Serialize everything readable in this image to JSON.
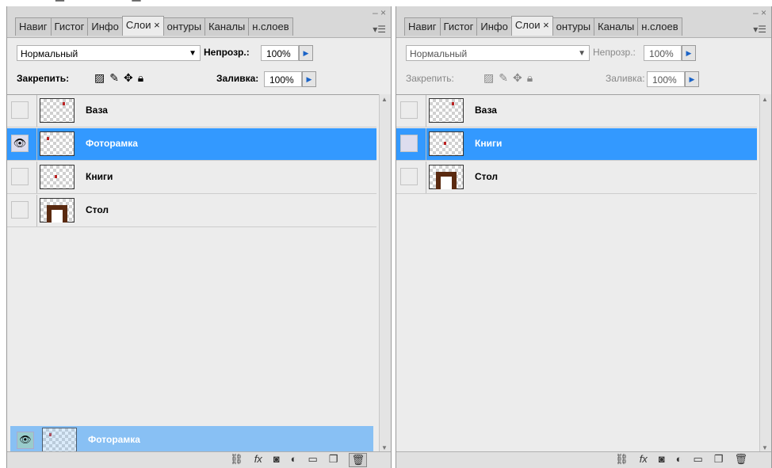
{
  "panels": [
    {
      "tabs": [
        {
          "label": "Навиг"
        },
        {
          "label": "Гистог"
        },
        {
          "label": "Инфо"
        },
        {
          "label": "Слои ×",
          "active": true
        },
        {
          "label": "онтуры"
        },
        {
          "label": "Каналы"
        },
        {
          "label": "н.слоев"
        }
      ],
      "close_label": "– ×",
      "menu_label": "▾☰",
      "blend_mode": "Нормальный",
      "opacity_label": "Непрозр.:",
      "opacity_value": "100%",
      "lock_label": "Закрепить:",
      "fill_label": "Заливка:",
      "fill_value": "100%",
      "layers": [
        {
          "name": "Ваза",
          "visible": false,
          "selected": false,
          "thumb": "vase"
        },
        {
          "name": "Фоторамка",
          "visible": true,
          "selected": true,
          "thumb": "frame"
        },
        {
          "name": "Книги",
          "visible": false,
          "selected": false,
          "thumb": "books"
        },
        {
          "name": "Стол",
          "visible": false,
          "selected": false,
          "thumb": "table"
        }
      ],
      "dragging_layer": "Фоторамка"
    },
    {
      "tabs": [
        {
          "label": "Навиг"
        },
        {
          "label": "Гистог"
        },
        {
          "label": "Инфо"
        },
        {
          "label": "Слои ×",
          "active": true
        },
        {
          "label": "онтуры"
        },
        {
          "label": "Каналы"
        },
        {
          "label": "н.слоев"
        }
      ],
      "close_label": "– ×",
      "menu_label": "▾☰",
      "blend_mode": "Нормальный",
      "opacity_label": "Непрозр.:",
      "opacity_value": "100%",
      "lock_label": "Закрепить:",
      "fill_label": "Заливка:",
      "fill_value": "100%",
      "layers": [
        {
          "name": "Ваза",
          "visible": false,
          "selected": false,
          "thumb": "vase"
        },
        {
          "name": "Книги",
          "visible": false,
          "selected": true,
          "thumb": "books"
        },
        {
          "name": "Стол",
          "visible": false,
          "selected": false,
          "thumb": "table"
        }
      ]
    }
  ],
  "icons": {
    "lock": [
      "lock-transparent-icon",
      "lock-brush-icon",
      "lock-move-icon",
      "lock-all-icon"
    ],
    "bottom": [
      "link-layers-icon",
      "fx-icon",
      "mask-icon",
      "adjustment-icon",
      "folder-icon",
      "new-layer-icon",
      "trash-icon"
    ]
  },
  "colors": {
    "selection": "#3399ff",
    "drag_ghost": "#88c0f4",
    "panel_bg": "#ececec"
  }
}
